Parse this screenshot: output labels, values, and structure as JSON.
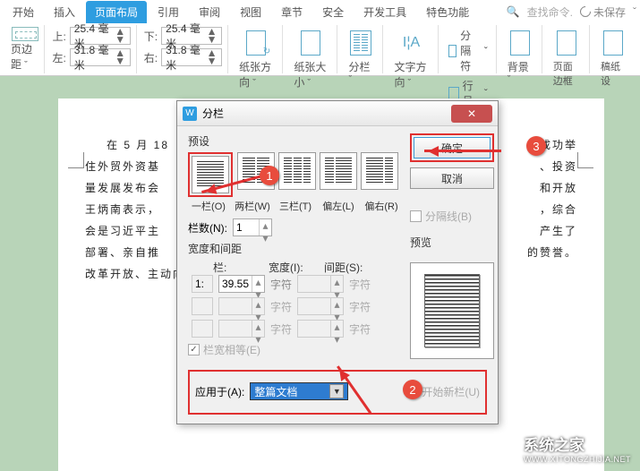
{
  "tabs": {
    "start": "开始",
    "insert": "插入",
    "layout": "页面布局",
    "ref": "引用",
    "review": "审阅",
    "view": "视图",
    "chapter": "章节",
    "security": "安全",
    "dev": "开发工具",
    "feature": "特色功能"
  },
  "search_placeholder": "查找命令.",
  "unsaved": "未保存",
  "margins": {
    "label": "页边距",
    "top": "上:",
    "bottom": "左:",
    "topv": "25.4 毫米",
    "botv": "31.8 毫米",
    "top2": "下:",
    "bot2": "右:",
    "top2v": "25.4 毫米",
    "bot2v": "31.8 毫米"
  },
  "btns": {
    "orient": "纸张方向",
    "size": "纸张大小",
    "cols": "分栏",
    "textdir": "文字方向",
    "break": "分隔符",
    "lineno": "行号",
    "bg": "背景",
    "border": "页面边框",
    "paper": "稿纸设"
  },
  "dialog": {
    "title": "分栏",
    "ok": "确定",
    "cancel": "取消",
    "presets_label": "预设",
    "p1": "一栏(O)",
    "p2": "两栏(W)",
    "p3": "三栏(T)",
    "p4": "偏左(L)",
    "p5": "偏右(R)",
    "num_label": "栏数(N):",
    "num_val": "1",
    "divider": "分隔线(B)",
    "wid_label": "宽度和间距",
    "preview_label": "预览",
    "col_h": "栏:",
    "wid_h": "宽度(I):",
    "gap_h": "间距(S):",
    "r1c": "1:",
    "r1w": "39.55",
    "unit": "字符",
    "unit2": "字符",
    "eq": "栏宽相等(E)",
    "apply": "应用于(A):",
    "apply_val": "整篇文档",
    "newcol": "开始新栏(U)"
  },
  "badges": {
    "b1": "1",
    "b2": "2",
    "b3": "3"
  },
  "bodytext": {
    "l1": "在 5 月 18",
    "l1b": "成功举",
    "l2": "住外贸外资基",
    "l2b": "、投资",
    "l3": "量发展发布会",
    "l3b": "和开放",
    "l4": "王炳南表示，",
    "l4b": "，综合",
    "l5": "会是习近平主",
    "l5b": "产生了",
    "l6": "部署、亲自推",
    "l6b": "的赞誉。",
    "l7": "改革开放、主动向世界开放市场"
  },
  "watermark": {
    "cn": "系统之家",
    "en": "WWW.XITONGZHIJIA.NET"
  }
}
